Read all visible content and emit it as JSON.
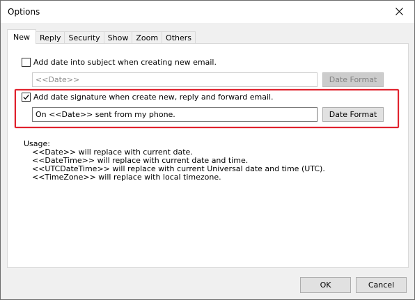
{
  "window": {
    "title": "Options"
  },
  "tabs": [
    {
      "label": "New",
      "active": true
    },
    {
      "label": "Reply",
      "active": false
    },
    {
      "label": "Security",
      "active": false
    },
    {
      "label": "Show",
      "active": false
    },
    {
      "label": "Zoom",
      "active": false
    },
    {
      "label": "Others",
      "active": false
    }
  ],
  "subject_option": {
    "label": "Add date into subject when creating new email.",
    "checked": false,
    "field_value": "<<Date>>",
    "button_label": "Date Format"
  },
  "signature_option": {
    "label": "Add date signature when create new, reply and forward email.",
    "checked": true,
    "field_value": "On <<Date>> sent from my phone.",
    "button_label": "Date Format"
  },
  "usage": {
    "heading": "Usage:",
    "lines": [
      "<<Date>> will replace with current date.",
      "<<DateTime>> will replace with current date and time.",
      "<<UTCDateTime>> will replace with current Universal date and time (UTC).",
      "<<TimeZone>> will replace with local timezone."
    ]
  },
  "footer": {
    "ok_label": "OK",
    "cancel_label": "Cancel"
  },
  "colors": {
    "highlight": "#e0202c",
    "dialog_bg": "#f0f0f0"
  },
  "icons": {
    "close": "close-icon",
    "check": "checkmark-icon"
  }
}
